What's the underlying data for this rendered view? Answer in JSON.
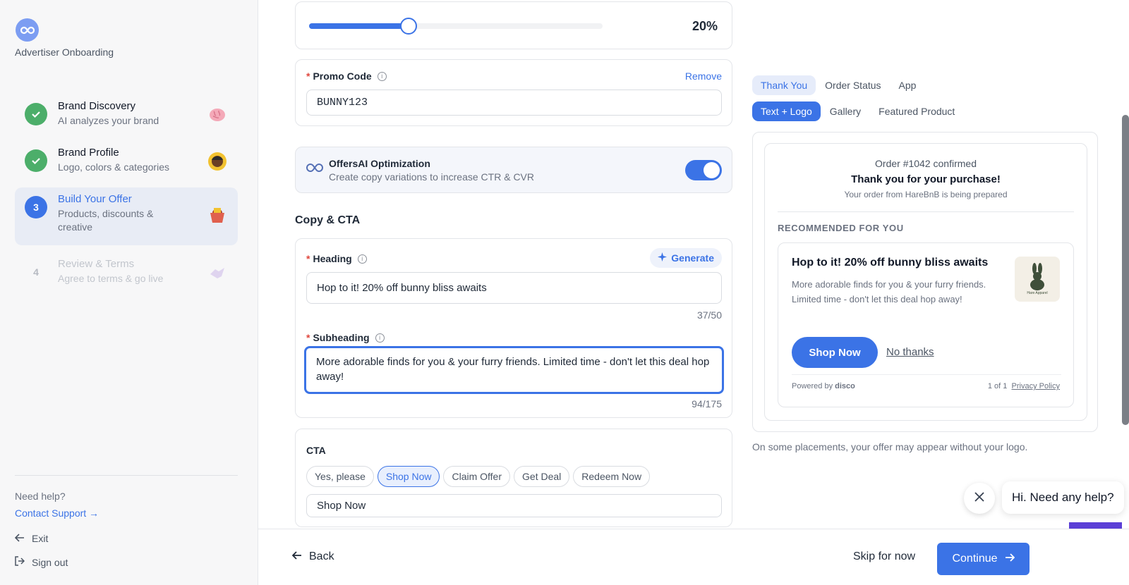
{
  "app_title": "Advertiser Onboarding",
  "steps": [
    {
      "num": "",
      "title": "Brand Discovery",
      "subtitle": "AI analyzes your brand"
    },
    {
      "num": "",
      "title": "Brand Profile",
      "subtitle": "Logo, colors & categories"
    },
    {
      "num": "3",
      "title": "Build Your Offer",
      "subtitle": "Products, discounts & creative"
    },
    {
      "num": "4",
      "title": "Review & Terms",
      "subtitle": "Agree to terms & go live"
    }
  ],
  "help": {
    "need_help": "Need help?",
    "contact": "Contact Support →",
    "exit": "Exit",
    "sign_out": "Sign out"
  },
  "discount": {
    "value": "20%",
    "level": 0.34
  },
  "promo": {
    "label": "Promo Code",
    "remove": "Remove",
    "value": "BUNNY123"
  },
  "optimization": {
    "title": "OffersAI Optimization",
    "desc": "Create copy variations to increase CTR & CVR",
    "enabled": true
  },
  "copy_section": "Copy & CTA",
  "heading": {
    "label": "Heading",
    "generate": "Generate",
    "value": "Hop to it! 20% off bunny bliss awaits",
    "count": "37/50"
  },
  "subheading": {
    "label": "Subheading",
    "value": "More adorable finds for you & your furry friends. Limited time - don't let this deal hop away!",
    "count": "94/175"
  },
  "cta": {
    "label": "CTA",
    "options": [
      "Yes, please",
      "Shop Now",
      "Claim Offer",
      "Get Deal",
      "Redeem Now"
    ],
    "selected": "Shop Now",
    "value": "Shop Now"
  },
  "preview_tabs": {
    "placement": [
      "Thank You",
      "Order Status",
      "App"
    ],
    "layout": [
      "Text + Logo",
      "Gallery",
      "Featured Product"
    ]
  },
  "preview": {
    "order": "Order #1042 confirmed",
    "thanks": "Thank you for your purchase!",
    "prepared": "Your order from HareBnB is being prepared",
    "recommended": "RECOMMENDED FOR YOU",
    "offer_heading": "Hop to it! 20% off bunny bliss awaits",
    "offer_body": "More adorable finds for you & your furry friends. Limited time - don't let this deal hop away!",
    "shop_now": "Shop Now",
    "no_thanks": "No thanks",
    "powered_prefix": "Powered by",
    "powered_brand": "disco",
    "page": "1 of 1",
    "privacy": "Privacy Policy",
    "logo_text": "Hare Apparel"
  },
  "preview_note": "On some placements, your offer may appear without your logo.",
  "chat": {
    "message": "Hi. Need any help?"
  },
  "footer": {
    "back": "Back",
    "skip": "Skip for now",
    "continue": "Continue"
  },
  "colors": {
    "accent": "#3b73e6",
    "success": "#4cae6a",
    "chat": "#5b3fd6"
  }
}
